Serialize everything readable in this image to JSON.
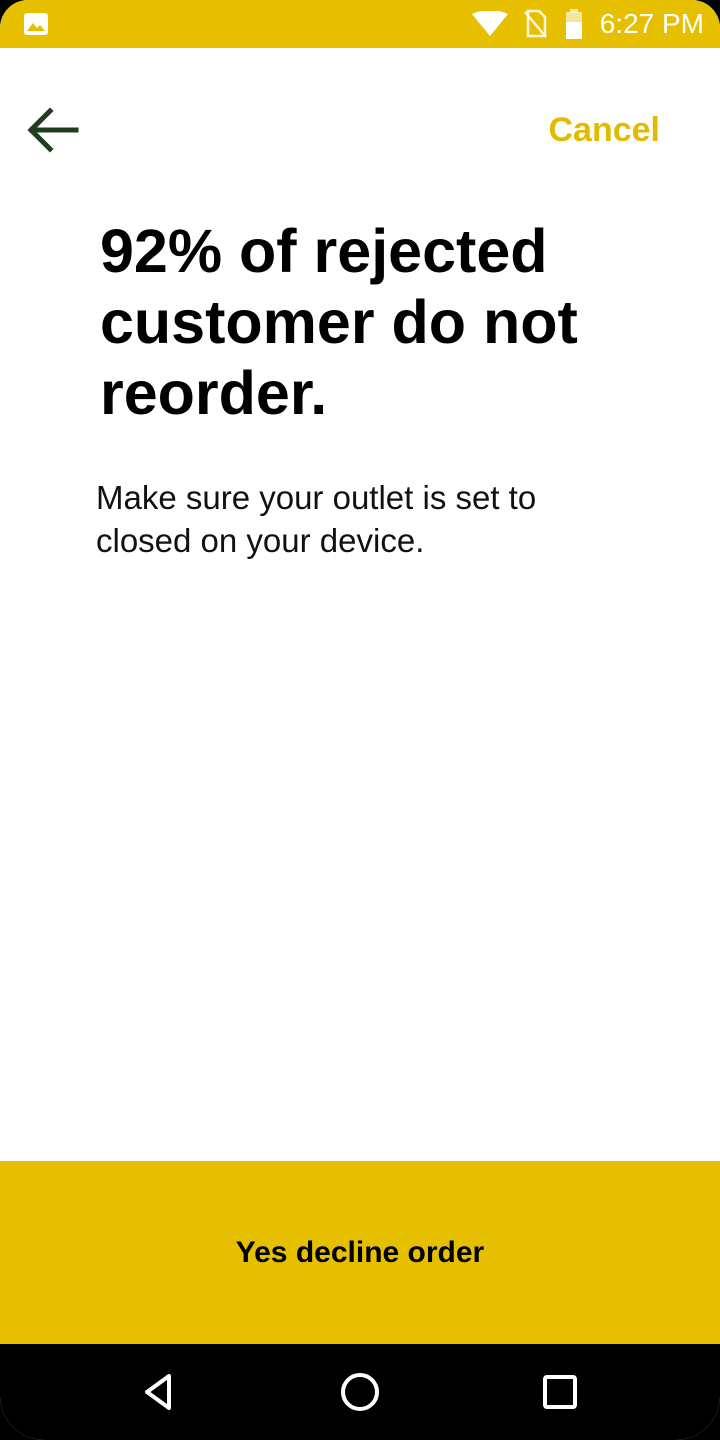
{
  "status_bar": {
    "time": "6:27 PM",
    "icons": [
      "gallery-icon",
      "wifi-icon",
      "no-sim-icon",
      "battery-icon"
    ],
    "color": "#e6c000"
  },
  "header": {
    "back_icon": "arrow-left-icon",
    "cancel_label": "Cancel",
    "cancel_color": "#e2bb00"
  },
  "main": {
    "headline": "92% of rejected customer do not reorder.",
    "subtext": "Make sure your outlet is set to closed on your device."
  },
  "actions": {
    "decline_label": "Yes decline order",
    "button_color": "#e6c000"
  },
  "nav_bar": {
    "buttons": [
      "triangle-back-icon",
      "circle-home-icon",
      "square-recents-icon"
    ]
  }
}
